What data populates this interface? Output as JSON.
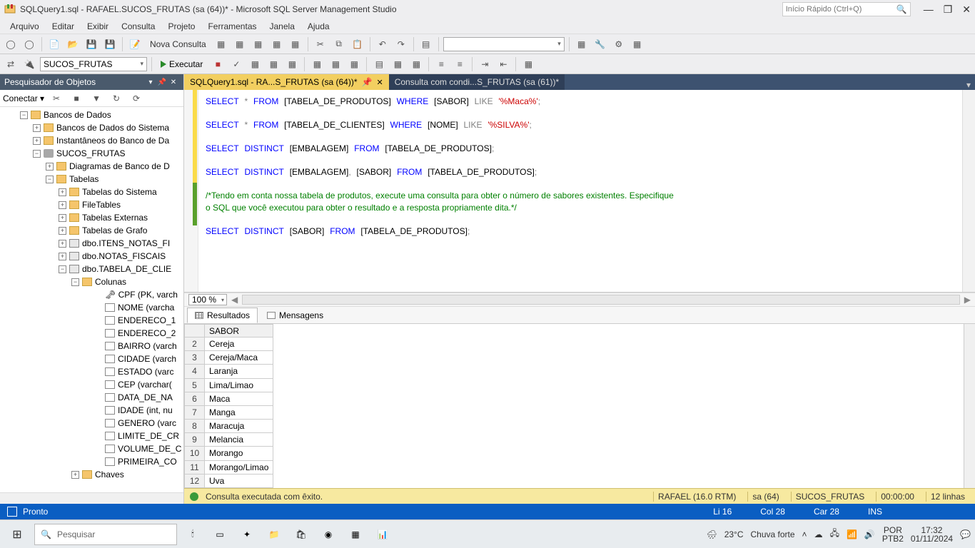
{
  "window": {
    "title": "SQLQuery1.sql - RAFAEL.SUCOS_FRUTAS (sa (64))* - Microsoft SQL Server Management Studio",
    "quick_launch_placeholder": "Início Rápido (Ctrl+Q)"
  },
  "menu": [
    "Arquivo",
    "Editar",
    "Exibir",
    "Consulta",
    "Projeto",
    "Ferramentas",
    "Janela",
    "Ajuda"
  ],
  "toolbar1": {
    "nova_consulta": "Nova Consulta"
  },
  "toolbar2": {
    "db_dropdown": "SUCOS_FRUTAS",
    "executar": "Executar"
  },
  "object_explorer": {
    "title": "Pesquisador de Objetos",
    "conectar": "Conectar ▾"
  },
  "tree": {
    "root": "Bancos de Dados",
    "sys_db": "Bancos de Dados do Sistema",
    "snap": "Instantâneos do Banco de Da",
    "db": "SUCOS_FRUTAS",
    "diag": "Diagramas de Banco de D",
    "tabelas": "Tabelas",
    "sys_tables": "Tabelas do Sistema",
    "filetables": "FileTables",
    "ext_tables": "Tabelas Externas",
    "graph_tables": "Tabelas de Grafo",
    "t1": "dbo.ITENS_NOTAS_FI",
    "t2": "dbo.NOTAS_FISCAIS",
    "t3": "dbo.TABELA_DE_CLIE",
    "colunas": "Colunas",
    "cols": [
      "CPF (PK, varch",
      "NOME (varcha",
      "ENDERECO_1",
      "ENDERECO_2",
      "BAIRRO (varch",
      "CIDADE (varch",
      "ESTADO (varc",
      "CEP (varchar(",
      "DATA_DE_NA",
      "IDADE (int, nu",
      "GENERO (varc",
      "LIMITE_DE_CR",
      "VOLUME_DE_C",
      "PRIMEIRA_CO"
    ],
    "chaves": "Chaves"
  },
  "tabs": {
    "active": "SQLQuery1.sql - RA...S_FRUTAS (sa (64))*",
    "inactive": "Consulta com condi...S_FRUTAS (sa (61))*"
  },
  "code": {
    "l1a": "SELECT",
    "l1b": "FROM",
    "l1c": "[TABELA_DE_PRODUTOS]",
    "l1d": "WHERE",
    "l1e": "[SABOR]",
    "l1f": "LIKE",
    "l1g": "'%Maca%'",
    "l2a": "SELECT",
    "l2b": "FROM",
    "l2c": "[TABELA_DE_CLIENTES]",
    "l2d": "WHERE",
    "l2e": "[NOME]",
    "l2f": "LIKE",
    "l2g": "'%SILVA%'",
    "l3a": "SELECT",
    "l3b": "DISTINCT",
    "l3c": "[EMBALAGEM]",
    "l3d": "FROM",
    "l3e": "[TABELA_DE_PRODUTOS]",
    "l4a": "SELECT",
    "l4b": "DISTINCT",
    "l4c": "[EMBALAGEM]",
    "l4d": "[SABOR]",
    "l4e": "FROM",
    "l4f": "[TABELA_DE_PRODUTOS]",
    "c1": "/*Tendo em conta nossa tabela de produtos, execute uma consulta para obter o número de sabores existentes. Especifique",
    "c2": "o SQL que você executou para obter o resultado e a resposta propriamente dita.*/",
    "l5a": "SELECT",
    "l5b": "DISTINCT",
    "l5c": "[SABOR]",
    "l5d": "FROM",
    "l5e": "[TABELA_DE_PRODUTOS]"
  },
  "zoom": "100 %",
  "result_tabs": {
    "resultados": "Resultados",
    "mensagens": "Mensagens"
  },
  "grid": {
    "header": "SABOR",
    "rows": [
      {
        "n": "2",
        "v": "Cereja"
      },
      {
        "n": "3",
        "v": "Cereja/Maca"
      },
      {
        "n": "4",
        "v": "Laranja"
      },
      {
        "n": "5",
        "v": "Lima/Limao"
      },
      {
        "n": "6",
        "v": "Maca"
      },
      {
        "n": "7",
        "v": "Manga"
      },
      {
        "n": "8",
        "v": "Maracuja"
      },
      {
        "n": "9",
        "v": "Melancia"
      },
      {
        "n": "10",
        "v": "Morango"
      },
      {
        "n": "11",
        "v": "Morango/Limao"
      },
      {
        "n": "12",
        "v": "Uva"
      }
    ]
  },
  "exec_status": {
    "msg": "Consulta executada com êxito.",
    "server": "RAFAEL (16.0 RTM)",
    "user": "sa (64)",
    "db": "SUCOS_FRUTAS",
    "time": "00:00:00",
    "rows": "12 linhas"
  },
  "bottom_status": {
    "ready": "Pronto",
    "ln": "Li 16",
    "col": "Col 28",
    "car": "Car 28",
    "ins": "INS"
  },
  "taskbar": {
    "search": "Pesquisar",
    "weather_temp": "23°C",
    "weather_desc": "Chuva forte",
    "lang1": "POR",
    "lang2": "PTB2",
    "time": "17:32",
    "date": "01/11/2024"
  }
}
